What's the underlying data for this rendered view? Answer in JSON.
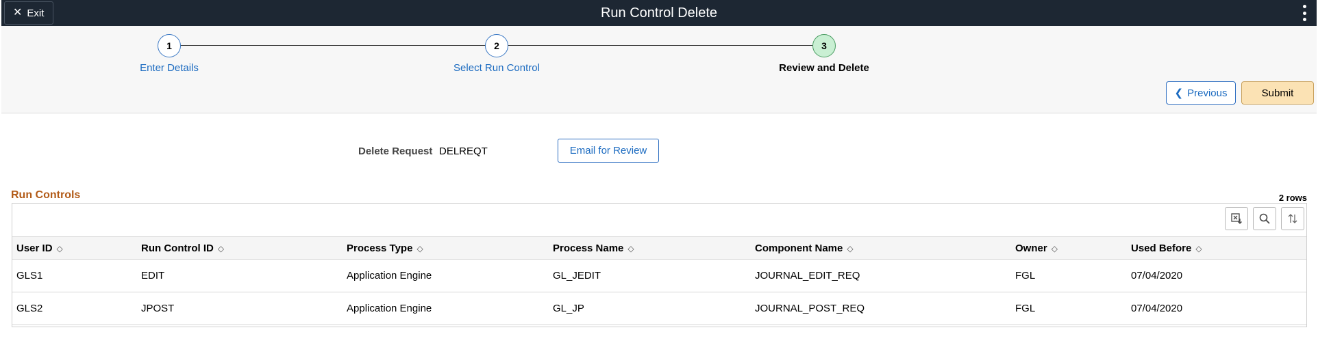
{
  "header": {
    "exit_label": "Exit",
    "title": "Run Control Delete"
  },
  "train": {
    "steps": [
      {
        "number": "1",
        "label": "Enter Details",
        "state": "visited"
      },
      {
        "number": "2",
        "label": "Select Run Control",
        "state": "visited"
      },
      {
        "number": "3",
        "label": "Review and Delete",
        "state": "current"
      }
    ],
    "previous_label": "Previous",
    "submit_label": "Submit"
  },
  "request": {
    "label": "Delete Request",
    "value": "DELREQT",
    "email_label": "Email for Review"
  },
  "grid": {
    "title": "Run Controls",
    "rows_count": "2 rows",
    "toolbar": [
      "export-icon",
      "search-icon",
      "sort-icon"
    ],
    "columns": [
      "User ID",
      "Run Control ID",
      "Process Type",
      "Process Name",
      "Component Name",
      "Owner",
      "Used Before"
    ],
    "rows": [
      [
        "GLS1",
        "EDIT",
        "Application Engine",
        "GL_JEDIT",
        "JOURNAL_EDIT_REQ",
        "FGL",
        "07/04/2020"
      ],
      [
        "GLS2",
        "JPOST",
        "Application Engine",
        "GL_JP",
        "JOURNAL_POST_REQ",
        "FGL",
        "07/04/2020"
      ]
    ]
  },
  "colors": {
    "header_bg": "#1d2733",
    "link_blue": "#1a6ac0",
    "section_title": "#b25b18",
    "submit_bg": "#fbe2b4",
    "current_step": "#c9efd3"
  }
}
